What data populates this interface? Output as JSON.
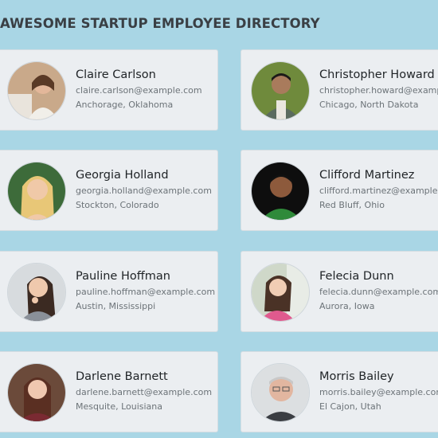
{
  "header": {
    "title": "AWESOME STARTUP EMPLOYEE DIRECTORY"
  },
  "employees": [
    {
      "name": "Claire Carlson",
      "email": "claire.carlson@example.com",
      "location": "Anchorage, Oklahoma"
    },
    {
      "name": "Christopher Howard",
      "email": "christopher.howard@example.com",
      "location": "Chicago, North Dakota"
    },
    {
      "name": "Georgia Holland",
      "email": "georgia.holland@example.com",
      "location": "Stockton, Colorado"
    },
    {
      "name": "Clifford Martinez",
      "email": "clifford.martinez@example.com",
      "location": "Red Bluff, Ohio"
    },
    {
      "name": "Pauline Hoffman",
      "email": "pauline.hoffman@example.com",
      "location": "Austin, Mississippi"
    },
    {
      "name": "Felecia Dunn",
      "email": "felecia.dunn@example.com",
      "location": "Aurora, Iowa"
    },
    {
      "name": "Darlene Barnett",
      "email": "darlene.barnett@example.com",
      "location": "Mesquite, Louisiana"
    },
    {
      "name": "Morris Bailey",
      "email": "morris.bailey@example.com",
      "location": "El Cajon, Utah"
    }
  ]
}
